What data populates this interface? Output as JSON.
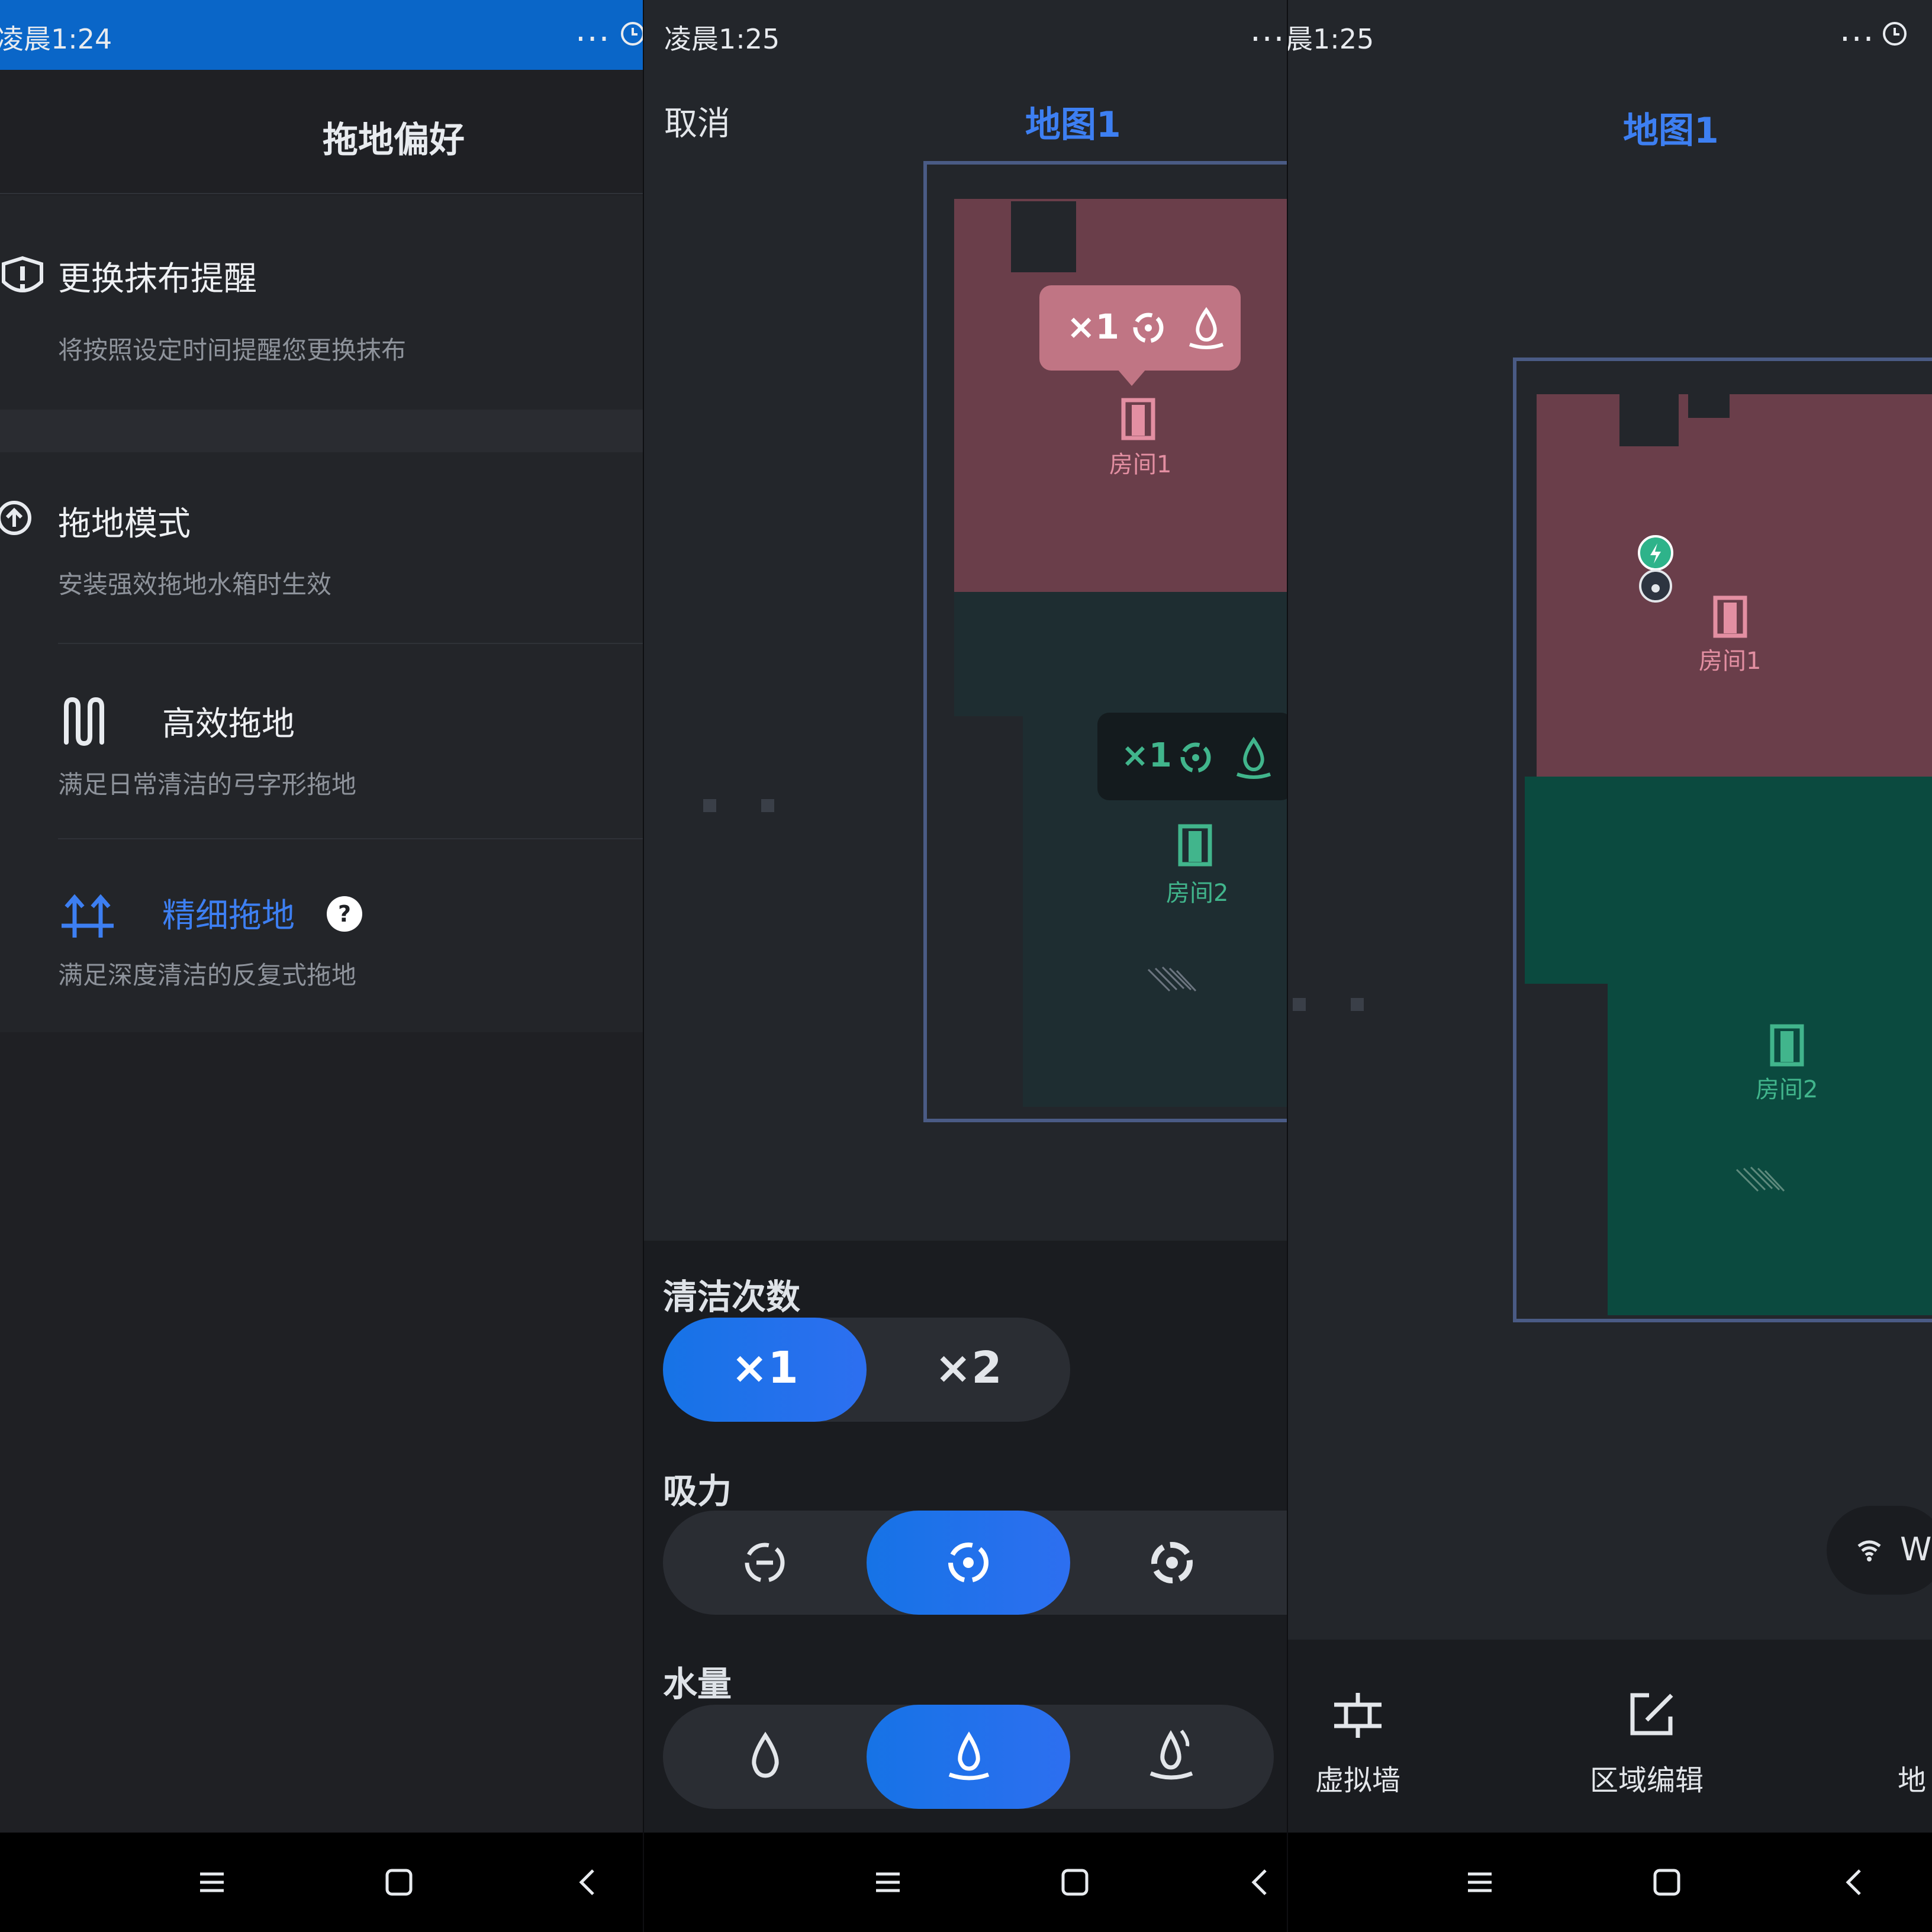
{
  "colors": {
    "accent": "#3d7ff2",
    "status_blue": "#0a66c8",
    "room1": "#6a3e4a",
    "room2": "#1e2d31",
    "room2_bright": "#0b4a3f",
    "room1_text": "#e38fa2",
    "room2_text": "#41b58c"
  },
  "screen1": {
    "status_time": "凌晨1:24",
    "status_dots": "...",
    "title": "拖地偏好",
    "reminder": {
      "title": "更换抹布提醒",
      "sub": "将按照设定时间提醒您更换抹布",
      "icon": "alert-shield-icon"
    },
    "mode": {
      "title": "拖地模式",
      "sub": "安装强效拖地水箱时生效",
      "icon": "mop-mode-icon"
    },
    "efficient": {
      "title": "高效拖地",
      "sub": "满足日常清洁的弓字形拖地",
      "icon": "zigzag-icon"
    },
    "fine": {
      "title": "精细拖地",
      "sub": "满足深度清洁的反复式拖地",
      "icon": "double-arrow-icon",
      "help": "?"
    }
  },
  "screen2": {
    "status_time": "凌晨1:25",
    "status_dots": "...",
    "cancel": "取消",
    "map_title": "地图1",
    "room1": {
      "label": "房间1",
      "badge_count": "×1"
    },
    "room2": {
      "label": "房间2",
      "badge_count": "×1"
    },
    "clean_times": {
      "label": "清洁次数",
      "options": [
        "×1",
        "×2"
      ],
      "selected": 0
    },
    "suction": {
      "label": "吸力",
      "options": [
        "quiet-fan-icon",
        "standard-fan-icon",
        "strong-fan-icon"
      ],
      "selected": 1
    },
    "water": {
      "label": "水量",
      "options": [
        "low-water-icon",
        "medium-water-icon",
        "high-water-icon"
      ],
      "selected": 1
    }
  },
  "screen3": {
    "status_time": "晨1:25",
    "status_dots": "...",
    "map_title": "地图1",
    "room1": {
      "label": "房间1"
    },
    "room2": {
      "label": "房间2"
    },
    "wifi_chip": "W",
    "tools": [
      {
        "label": "虚拟墙",
        "icon": "virtual-wall-icon"
      },
      {
        "label": "区域编辑",
        "icon": "area-edit-icon"
      },
      {
        "label": "地",
        "icon": "map-icon"
      }
    ]
  }
}
